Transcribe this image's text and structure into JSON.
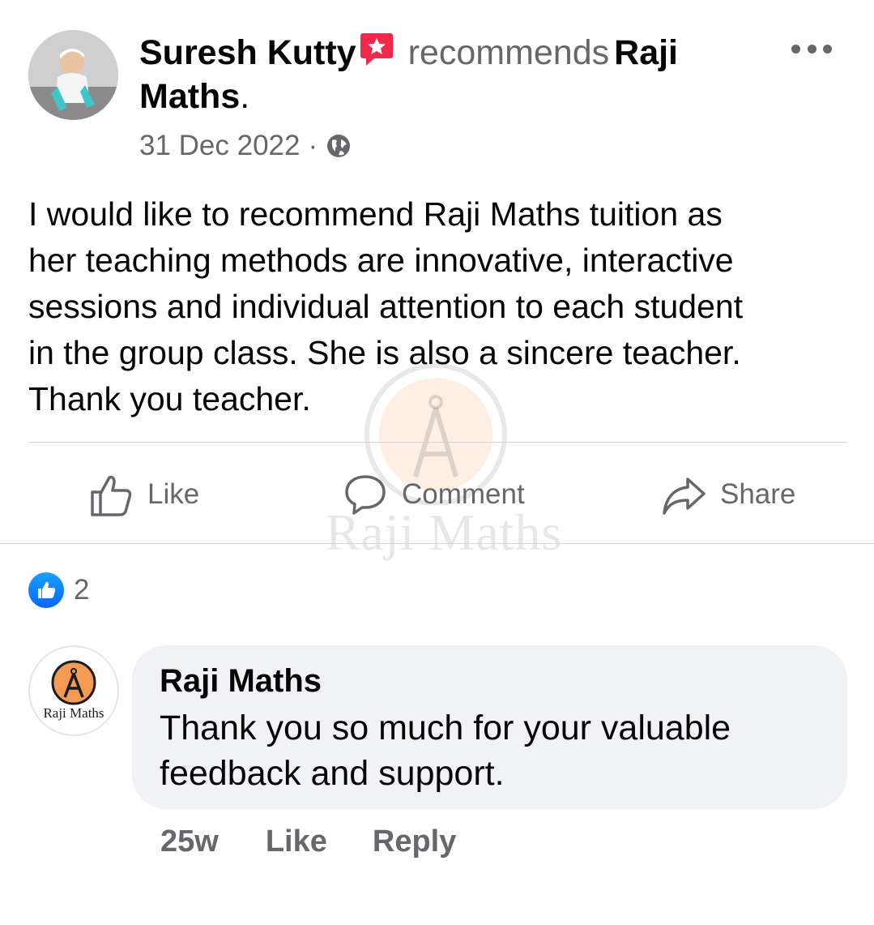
{
  "post": {
    "author": "Suresh Kutty",
    "badge_icon": "recommend-badge-icon",
    "verb": "recommends",
    "page_name": "Raji Maths",
    "period": ".",
    "date": "31 Dec 2022",
    "separator": "·",
    "privacy_icon": "globe-icon",
    "body": "I would like to recommend Raji Maths tuition as\nher teaching methods  are innovative,  interactive\nsessions and individual attention to each student\nin the group class. She is also a sincere teacher.\nThank you teacher.",
    "more_icon": "more-options-icon"
  },
  "actions": {
    "like": "Like",
    "comment": "Comment",
    "share": "Share"
  },
  "reactions": {
    "count": "2",
    "icon": "like-reaction-icon"
  },
  "watermark": {
    "text": "Raji Maths"
  },
  "comment": {
    "author": "Raji Maths",
    "avatar_logo_text": "Raji Maths",
    "text": "Thank you so much for your valuable feedback and support.",
    "time": "25w",
    "like": "Like",
    "reply": "Reply"
  },
  "colors": {
    "secondary_text": "#65676b",
    "like_blue": "#0866ff",
    "bubble": "#f0f2f5",
    "badge_red": "#f02849",
    "logo_orange": "#f39a55"
  }
}
